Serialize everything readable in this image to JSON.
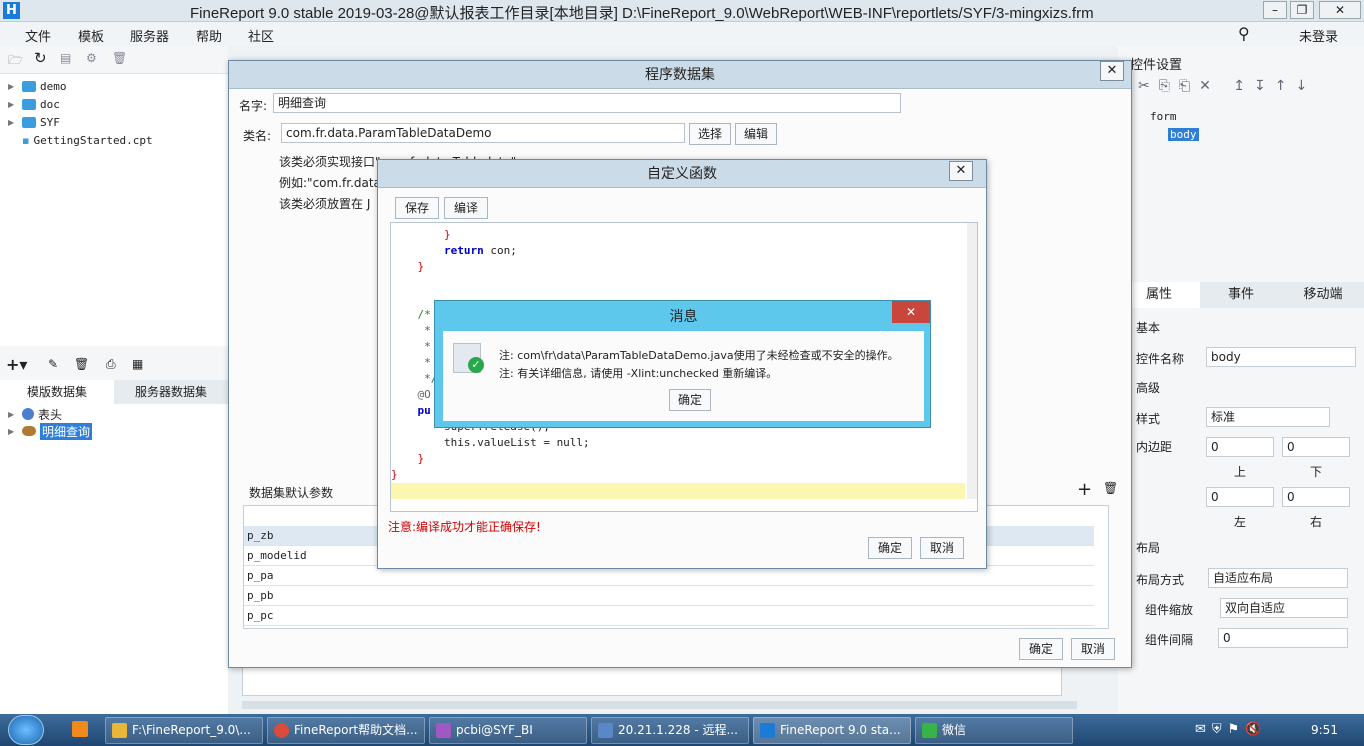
{
  "window": {
    "title": "FineReport 9.0 stable 2019-03-28@默认报表工作目录[本地目录]     D:\\FineReport_9.0\\WebReport\\WEB-INF\\reportlets/SYF/3-mingxizs.frm"
  },
  "menu": [
    "文件",
    "模板",
    "服务器",
    "帮助",
    "社区"
  ],
  "login": "未登录",
  "tree": [
    "demo",
    "doc",
    "SYF",
    "GettingStarted.cpt"
  ],
  "ds_tabs": [
    "模版数据集",
    "服务器数据集"
  ],
  "ds_items": [
    "表头",
    "明细查询"
  ],
  "prog_dialog": {
    "title": "程序数据集",
    "name_label": "名字:",
    "name_value": "明细查询",
    "class_label": "类名:",
    "class_value": "com.fr.data.ParamTableDataDemo",
    "select_btn": "选择",
    "edit_btn": "编辑",
    "note1": "该类必须实现接口\"com.fr.data.Tabledata\"",
    "note2": "例如:\"com.fr.data",
    "note3": "该类必须放置在 J",
    "params_label": "数据集默认参数",
    "params": [
      "p_zb",
      "p_modelid",
      "p_pa",
      "p_pb",
      "p_pc"
    ],
    "ok": "确定",
    "cancel": "取消"
  },
  "func_dialog": {
    "title": "自定义函数",
    "save": "保存",
    "compile": "编译",
    "warn": "注意:编译成功才能正确保存!",
    "ok": "确定",
    "cancel": "取消",
    "code": [
      "        }",
      "        return con;",
      "    }",
      "",
      "",
      "    /*",
      "     *",
      "     *",
      "     *",
      "     */",
      "    @O",
      "    pu",
      "        super.release();",
      "        this.valueList = null;",
      "    }",
      "}"
    ]
  },
  "msg_dialog": {
    "title": "消息",
    "line1": "注: com\\fr\\data\\ParamTableDataDemo.java使用了未经检查或不安全的操作。",
    "line2": "注: 有关详细信息, 请使用 -Xlint:unchecked 重新编译。",
    "ok": "确定"
  },
  "right": {
    "title": "控件设置",
    "tree": [
      "form",
      "body"
    ],
    "tabs": [
      "属性",
      "事件",
      "移动端"
    ],
    "basic": "基本",
    "ctrl_name_label": "控件名称",
    "ctrl_name": "body",
    "advanced": "高级",
    "style_label": "样式",
    "style": "标准",
    "padding_label": "内边距",
    "pad_top": "0",
    "pad_bottom": "0",
    "pad_left": "0",
    "pad_right": "0",
    "top": "上",
    "bottom": "下",
    "left": "左",
    "rightl": "右",
    "layout": "布局",
    "layout_mode_label": "布局方式",
    "layout_mode": "自适应布局",
    "scale_label": "组件缩放",
    "scale": "双向自适应",
    "gap_label": "组件间隔",
    "gap": "0"
  },
  "taskbar": {
    "items": [
      "F:\\FineReport_9.0\\...",
      "FineReport帮助文档...",
      "pcbi@SYF_BI",
      "20.21.1.228 - 远程...",
      "FineReport 9.0 sta...",
      "微信"
    ],
    "time": "9:51"
  }
}
